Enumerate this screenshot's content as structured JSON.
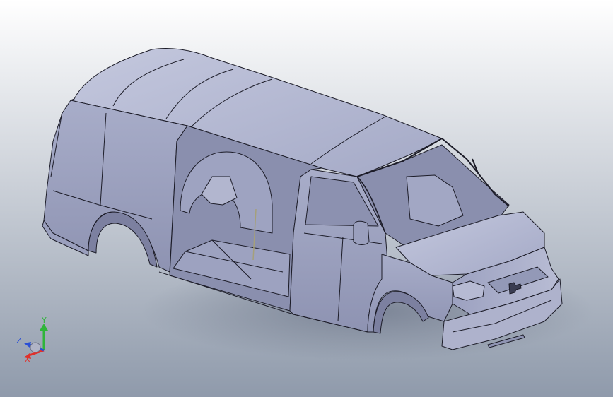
{
  "viewport": {
    "background_top": "#ffffff",
    "background_bottom": "#8f9aab",
    "model_fill": "#a4a9c6",
    "model_shade": "#7c80a0",
    "model_light": "#c4c8de",
    "edge_color": "#1c1c28",
    "shadow_color": "#6d7689"
  },
  "model": {
    "name": "cargo-van-body",
    "parts": [
      "roof",
      "side-panel",
      "sliding-door-opening",
      "wheel-well-rear",
      "front-door",
      "hood",
      "grille",
      "front-bumper",
      "windshield-frame",
      "side-mirror"
    ]
  },
  "triad": {
    "x_label": "X",
    "y_label": "Y",
    "z_label": "Z",
    "x_color": "#e0302a",
    "y_color": "#2fb53a",
    "z_color": "#2a4fd6"
  }
}
